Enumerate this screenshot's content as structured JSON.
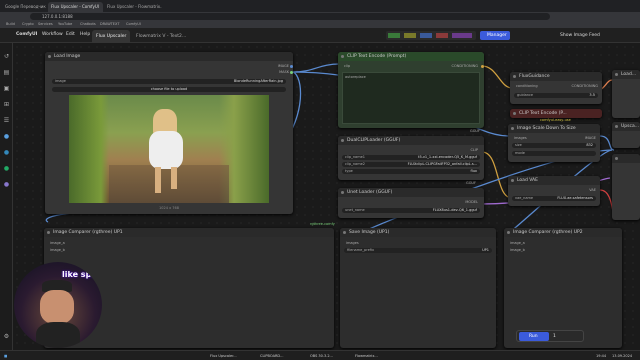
{
  "browser": {
    "tabs": [
      "Google Переводчик",
      "Flux Upscaler - ComfyUI",
      "Flux Upscaler - Flowmatrix..."
    ],
    "url": "127.0.0.1:8188",
    "bookmarks": [
      "Build",
      "Crypto",
      "Services",
      "YouTube",
      "Chatbots",
      "DRAWTEXT",
      "ComfyUI"
    ]
  },
  "menu": {
    "logo": "ComfyUI",
    "items": [
      "Workflow",
      "Edit",
      "Help"
    ],
    "tabs": [
      "Flux Upscaler",
      "Flowmatrix V - Text2..."
    ],
    "manager": "Manager",
    "share": "Show Image Feed"
  },
  "nodes": {
    "load_image": {
      "title": "Load Image",
      "image_label": "image",
      "image_value": "BlondeRunningAfterRain.jpg",
      "upload": "choose file to upload",
      "out_image": "IMAGE",
      "out_mask": "MASK",
      "size": "1024 x 768"
    },
    "clip_text_pos": {
      "title": "CLIP Text Encode (Prompt)",
      "in_clip": "clip",
      "out_cond": "CONDITIONING",
      "text": "autoreplace"
    },
    "flux_guidance": {
      "title": "FluxGuidance",
      "in": "conditioning",
      "out": "CONDITIONING",
      "guidance_label": "guidance",
      "guidance_value": "3.5"
    },
    "clip_text_neg": {
      "title": "CLIP Text Encode (P...",
      "sub": "comfyui-easy-use"
    },
    "scale_down": {
      "title": "Image Scale Down To Size",
      "in_images": "images",
      "size_label": "size",
      "size_value": "832",
      "mode_label": "mode",
      "out": "IMAGE"
    },
    "dual_clip": {
      "title": "DualCLIPLoader (GGUF)",
      "clip1_label": "clip_name1",
      "clip1_value": "t5-v1_1-xxl-encoder-Q5_K_M.gguf",
      "clip2_label": "clip_name2",
      "clip2_value": "FLUXclipL.CLIPGFailFP32_onfall.clipL.s...",
      "type_label": "type",
      "type_value": "flux",
      "out": "CLIP"
    },
    "unet": {
      "title": "Unet Loader (GGUF)",
      "unet_label": "unet_name",
      "unet_value": "FLUX8us1-dev-Q6_1.gguf",
      "out": "MODEL"
    },
    "vae": {
      "title": "Load VAE",
      "vae_label": "vae_name",
      "vae_value": "FLUX.ae.safetensors",
      "out": "VAE"
    },
    "comparer1": {
      "title": "Image Comparer (rgthree) UP1",
      "a": "image_a",
      "b": "image_b"
    },
    "save": {
      "title": "Save Image (UP1)",
      "in": "images",
      "prefix_label": "filename_prefix",
      "prefix_value": "UP1"
    },
    "comparer2": {
      "title": "Image Comparer (rgthree) UP2",
      "a": "image_a",
      "b": "image_b"
    },
    "upscale_r": {
      "title": "Upsca..."
    },
    "load_r": {
      "title": "Load..."
    }
  },
  "labels": {
    "rgthree": "rgthree-comfy",
    "ggup1": "GGUF",
    "ggup2": "GGUF"
  },
  "run": {
    "label": "Run",
    "count": "1"
  },
  "webcam": {
    "overlay": "like spide..."
  },
  "taskbar": {
    "items": [
      "Flux Upscaler...",
      "CLIPBOARD...",
      "OBS 30.3.2...",
      "Flowmatrix..."
    ],
    "time": "19:44",
    "date": "13.09.2024"
  }
}
